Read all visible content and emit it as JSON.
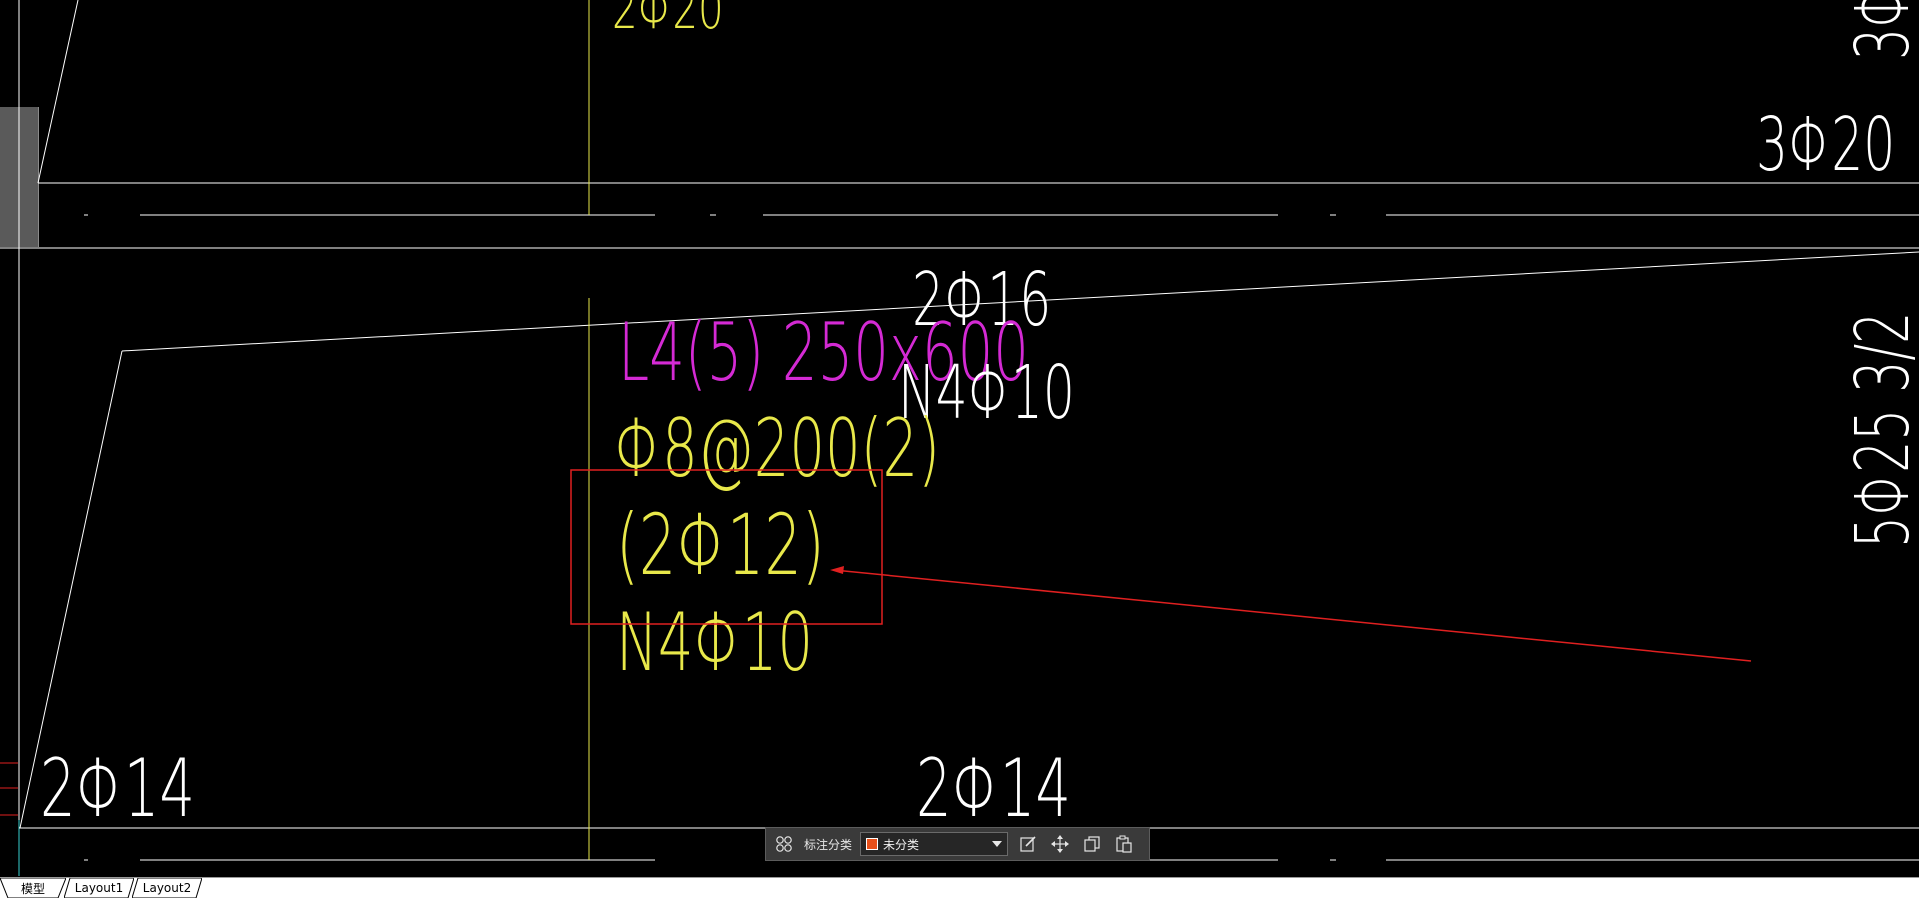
{
  "drawing": {
    "labels": {
      "top_rebar": "2Φ20",
      "right_top_rebar": "3Φ20",
      "upper_beam_rebar": "2Φ16",
      "beam_name": "L4(5) 250x600",
      "stirrup": "Φ8@200(2)",
      "waist_rebar_white": "N4Φ10",
      "erection_rebar": "(2Φ12)",
      "waist_rebar_yellow": "N4Φ10",
      "bottom_left_rebar": "2Φ14",
      "bottom_mid_rebar": "2Φ14",
      "right_vertical_rebar": "5Φ25 3/2",
      "right_top_vertical": "3Φ"
    },
    "colors": {
      "background": "#000000",
      "white_lines": "#ffffff",
      "yellow": "#e8e84a",
      "magenta": "#d42ad4",
      "red_markup": "#e02020"
    }
  },
  "annotation_toolbar": {
    "category_label": "标注分类",
    "selected_category": "未分类",
    "swatch_color": "#e8501a",
    "icons": [
      "grid-icon",
      "edit-icon",
      "move-icon",
      "copy-icon",
      "paste-icon"
    ]
  },
  "layout_tabs": {
    "model": "模型",
    "layout1": "Layout1",
    "layout2": "Layout2"
  }
}
